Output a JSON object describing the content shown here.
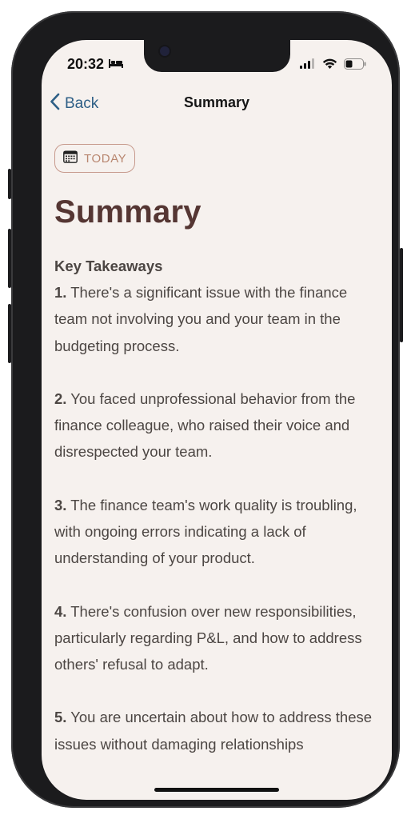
{
  "status_bar": {
    "time": "20:32",
    "sleep_icon": "bed-icon",
    "signal_icon": "cellular-signal-icon",
    "wifi_icon": "wifi-icon",
    "battery_icon": "battery-icon"
  },
  "nav": {
    "back_label": "Back",
    "title": "Summary"
  },
  "date_chip": {
    "label": "TODAY",
    "icon": "calendar-icon"
  },
  "page_title": "Summary",
  "takeaways": {
    "heading": "Key Takeaways",
    "items": [
      {
        "num": "1.",
        "text": " There's a significant issue with the finance team not involving you and your team in the budgeting process."
      },
      {
        "num": "2.",
        "text": " You faced unprofessional behavior from the finance colleague, who raised their voice and disrespected your team."
      },
      {
        "num": "3.",
        "text": " The finance team's work quality is troubling, with ongoing errors indicating a lack of understanding of your product."
      },
      {
        "num": "4.",
        "text": " There's confusion over new responsibilities, particularly regarding P&L, and how to address others' refusal to adapt."
      },
      {
        "num": "5.",
        "text": " You are uncertain about how to address these issues without damaging relationships"
      }
    ]
  },
  "colors": {
    "background": "#f6f1ee",
    "accent_link": "#2e5f86",
    "title_color": "#553633",
    "chip_border": "#c79a8d",
    "body_text": "#4c4643"
  }
}
